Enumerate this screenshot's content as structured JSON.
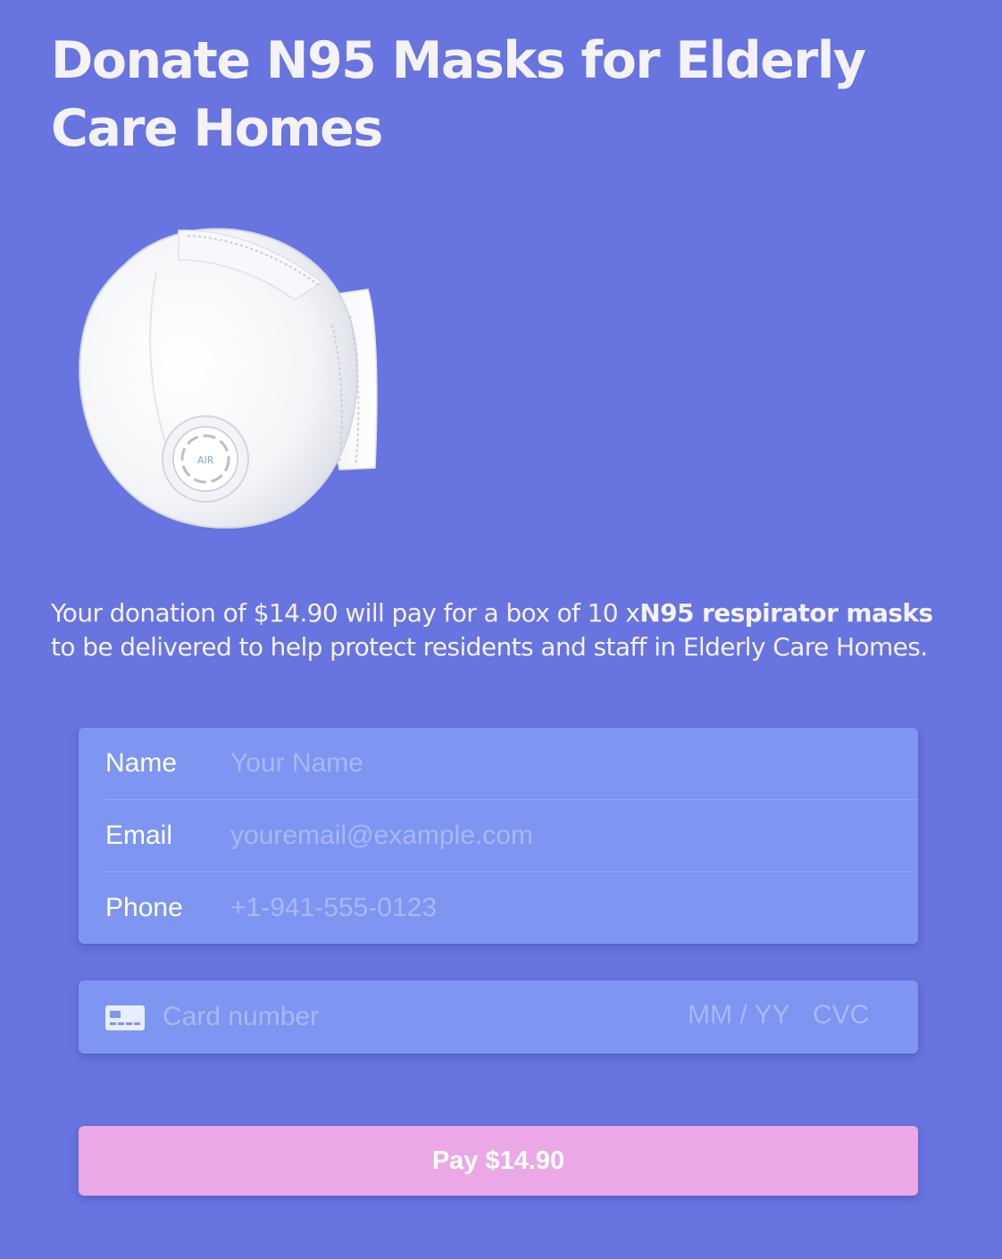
{
  "page": {
    "title": "Donate N95 Masks for Elderly Care Homes"
  },
  "product": {
    "image_alt": "N95 respirator mask",
    "valve_brand": "AIR"
  },
  "description": {
    "before": "Your donation of $14.90 will pay for a box of 10 x",
    "bold": "N95 respirator masks",
    "after": " to be delivered to help protect residents and staff in Elderly Care Homes."
  },
  "contact_form": {
    "name": {
      "label": "Name",
      "placeholder": "Your Name"
    },
    "email": {
      "label": "Email",
      "placeholder": "youremail@example.com"
    },
    "phone": {
      "label": "Phone",
      "placeholder": "+1-941-555-0123"
    }
  },
  "payment": {
    "card_icon": "credit-card-icon",
    "card_placeholder": "Card number",
    "expiry_placeholder": "MM / YY",
    "cvc_placeholder": "CVC"
  },
  "pay_button": {
    "label": "Pay $14.90"
  },
  "colors": {
    "background": "#6874df",
    "card": "#7e95f1",
    "pay_button": "#eaa8e6"
  }
}
